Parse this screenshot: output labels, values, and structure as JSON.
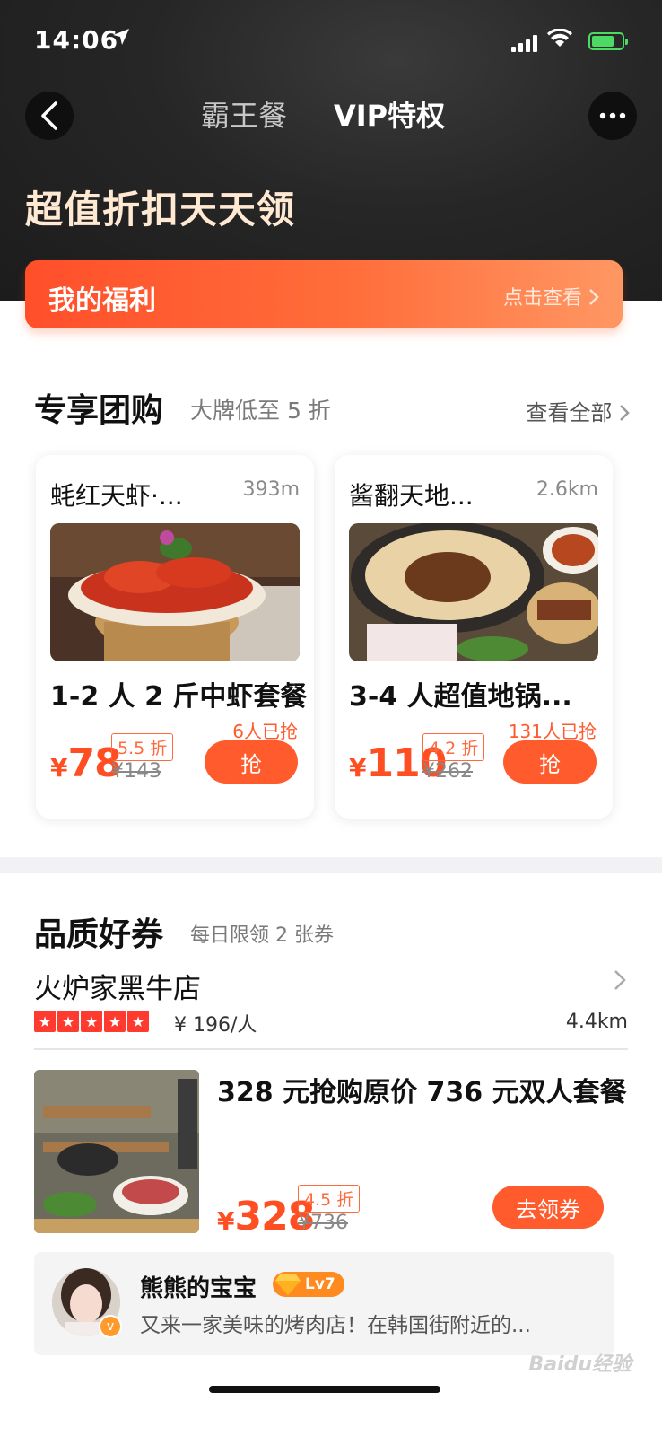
{
  "status_bar": {
    "time": "14:06",
    "location_icon": "location-arrow-icon"
  },
  "nav": {
    "tabs": [
      {
        "label": "霸王餐",
        "active": false
      },
      {
        "label": "VIP特权",
        "active": true
      }
    ]
  },
  "hero": {
    "title": "超值折扣天天领"
  },
  "welfare": {
    "title": "我的福利",
    "link": "点击查看"
  },
  "group_buy": {
    "title": "专享团购",
    "subtitle": "大牌低至 5 折",
    "see_all": "查看全部",
    "deals": [
      {
        "shop": "蚝红天虾·...",
        "distance": "393m",
        "title": "1-2 人 2 斤中虾套餐",
        "price": "78",
        "discount": "5.5 折",
        "original": "¥143",
        "sold": "6人已抢",
        "button": "抢"
      },
      {
        "shop": "酱翻天地...",
        "distance": "2.6km",
        "title": "3-4 人超值地锅...",
        "price": "110",
        "discount": "4.2 折",
        "original": "¥262",
        "sold": "131人已抢",
        "button": "抢"
      }
    ]
  },
  "coupons": {
    "title": "品质好券",
    "subtitle": "每日限领 2 张券",
    "shop": {
      "name": "火炉家黑牛店",
      "rating": 5,
      "per_person": "¥ 196/人",
      "distance": "4.4km"
    },
    "offer": {
      "title": "328 元抢购原价 736 元双人套餐",
      "price": "328",
      "discount": "4.5 折",
      "original": "¥736",
      "button": "去领券"
    },
    "review": {
      "user": "熊熊的宝宝",
      "level": "Lv7",
      "text": "又来一家美味的烤肉店！在韩国街附近的..."
    }
  },
  "currency": "¥",
  "watermark": "Baidu经验",
  "colors": {
    "accent": "#ff5b2c",
    "hero_bg": "#262626",
    "hero_title": "#ffe9d2",
    "star": "#ff3b30"
  }
}
